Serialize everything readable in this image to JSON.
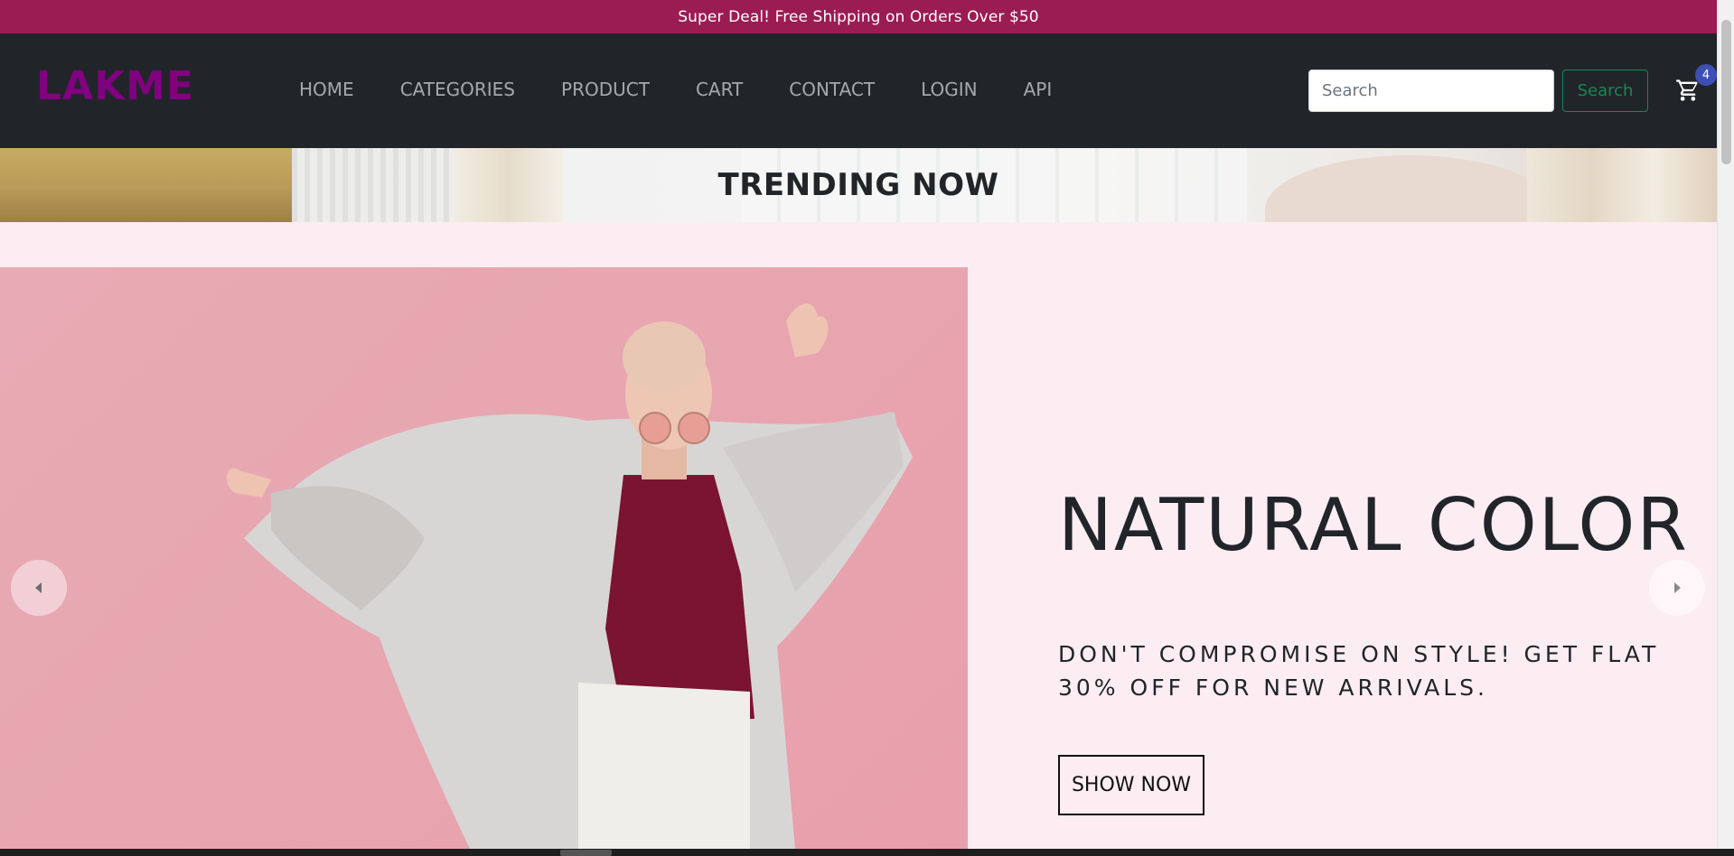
{
  "promo": {
    "text": "Super Deal! Free Shipping on Orders Over $50"
  },
  "navbar": {
    "brand": "LAKME",
    "links": [
      "HOME",
      "CATEGORIES",
      "PRODUCT",
      "CART",
      "CONTACT",
      "LOGIN",
      "API"
    ],
    "search": {
      "placeholder": "Search",
      "value": "",
      "button_label": "Search"
    },
    "cart": {
      "icon": "cart-icon",
      "badge_count": "4"
    }
  },
  "trending": {
    "title": "TRENDING NOW"
  },
  "hero": {
    "heading": "NATURAL COLOR",
    "subheading": "DON'T COMPROMISE ON STYLE! GET FLAT 30% OFF FOR NEW ARRIVALS.",
    "button_label": "SHOW NOW",
    "image": "model-in-fur-coat-photo",
    "prev_icon": "chevron-left-icon",
    "next_icon": "chevron-right-icon"
  },
  "colors": {
    "promo_bg": "#9b1c52",
    "navbar_bg": "#212529",
    "brand": "#800080",
    "page_bg": "#fcedf2",
    "search_button": "#198754",
    "cart_badge": "#3d4fb5"
  }
}
